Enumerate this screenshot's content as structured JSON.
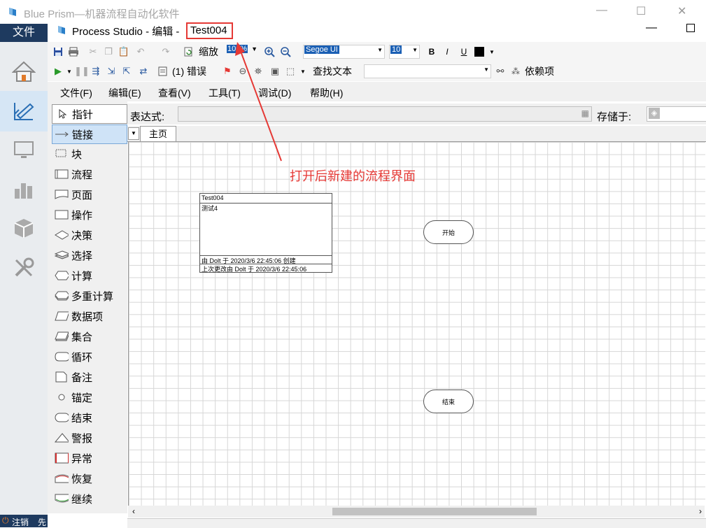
{
  "outer_window": {
    "title": "Blue Prism—机器流程自动化软件",
    "menu_label": "文件",
    "bottom_label": "注销",
    "bottom_label2": "先"
  },
  "window": {
    "app_name": "Process Studio",
    "mode": "- 编辑 -",
    "process_name": "Test004"
  },
  "toolbar1": {
    "zoom_label": "缩放",
    "zoom_value": "100%",
    "font_name": "Segoe UI",
    "font_size": "10",
    "bold": "B",
    "italic": "I",
    "underline": "U"
  },
  "toolbar2": {
    "errors_label": "(1) 错误",
    "find_text_label": "查找文本",
    "dependencies_label": "依赖项"
  },
  "menu": [
    "文件(F)",
    "编辑(E)",
    "查看(V)",
    "工具(T)",
    "调试(D)",
    "帮助(H)"
  ],
  "palette": [
    {
      "label": "指针",
      "icon": "pointer-icon"
    },
    {
      "label": "链接",
      "icon": "link-icon",
      "selected": true
    },
    {
      "label": "块",
      "icon": "block-icon"
    },
    {
      "label": "流程",
      "icon": "process-icon"
    },
    {
      "label": "页面",
      "icon": "page-icon"
    },
    {
      "label": "操作",
      "icon": "action-icon"
    },
    {
      "label": "决策",
      "icon": "decision-icon"
    },
    {
      "label": "选择",
      "icon": "choice-icon"
    },
    {
      "label": "计算",
      "icon": "calculation-icon"
    },
    {
      "label": "多重计算",
      "icon": "multi-calculation-icon"
    },
    {
      "label": "数据项",
      "icon": "data-item-icon"
    },
    {
      "label": "集合",
      "icon": "collection-icon"
    },
    {
      "label": "循环",
      "icon": "loop-icon"
    },
    {
      "label": "备注",
      "icon": "note-icon"
    },
    {
      "label": "锚定",
      "icon": "anchor-icon"
    },
    {
      "label": "结束",
      "icon": "end-icon"
    },
    {
      "label": "警报",
      "icon": "alert-icon"
    },
    {
      "label": "异常",
      "icon": "exception-icon"
    },
    {
      "label": "恢复",
      "icon": "recover-icon"
    },
    {
      "label": "继续",
      "icon": "resume-icon"
    }
  ],
  "expression": {
    "label": "表达式:",
    "store_label": "存储于:"
  },
  "tabs": {
    "main_page": "主页"
  },
  "canvas": {
    "info_box": {
      "name": "Test004",
      "description": "测试4",
      "created": "由 Dolt 于 2020/3/6  22:45:06 创建",
      "modified": "上次更改由 Dolt 于 2020/3/6 22:45:06"
    },
    "start_stage": "开始",
    "end_stage": "结束"
  },
  "annotation": "打开后新建的流程界面",
  "colors": {
    "accent": "#1e3a5f",
    "annotation": "#e53935",
    "selected": "#cfe3f7"
  }
}
